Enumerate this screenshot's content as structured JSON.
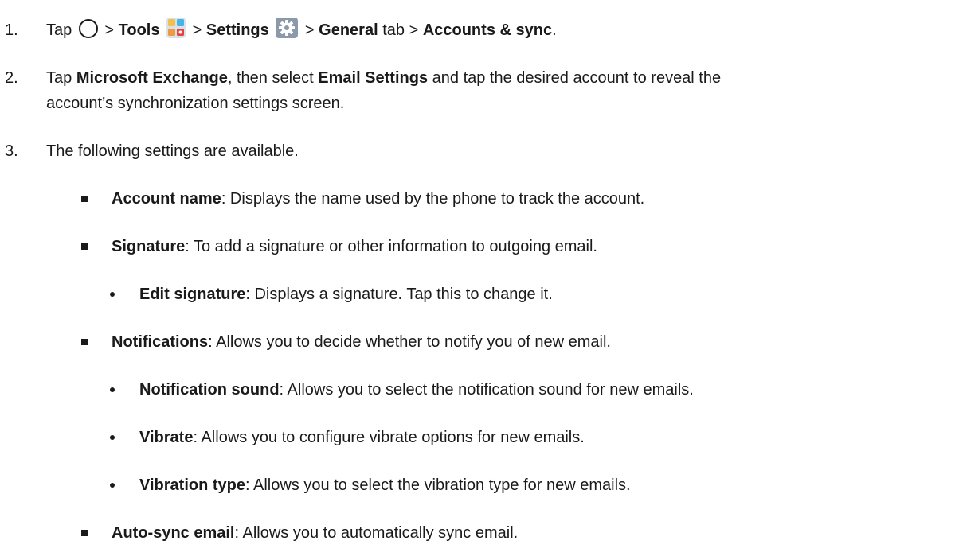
{
  "steps": [
    {
      "number": "1.",
      "tap": "Tap",
      "sep": ">",
      "tools": "Tools",
      "settings": "Settings",
      "general": "General",
      "tab": "tab",
      "accounts": "Accounts & sync",
      "period": "."
    },
    {
      "number": "2.",
      "tap": "Tap",
      "exchange": "Microsoft Exchange",
      "then_select": ", then select",
      "email_settings": "Email Settings",
      "rest_line1": "and tap the desired account to reveal the",
      "line2": "account’s synchronization settings screen."
    },
    {
      "number": "3.",
      "text": "The following settings are available."
    }
  ],
  "settings": [
    {
      "term": "Account name",
      "desc": ": Displays the name used by the phone to track the account."
    },
    {
      "term": "Signature",
      "desc": ": To add a signature or other information to outgoing email."
    },
    {
      "term": "Edit signature",
      "desc": ": Displays a signature. Tap this to change it."
    },
    {
      "term": "Notifications",
      "desc": ": Allows you to decide whether to notify you of new email."
    },
    {
      "term": "Notification sound",
      "desc": ": Allows you to select the notification sound for new emails."
    },
    {
      "term": "Vibrate",
      "desc": ": Allows you to configure vibrate options for new emails."
    },
    {
      "term": "Vibration type",
      "desc": ": Allows you to select the vibration type for new emails."
    },
    {
      "term": "Auto-sync email",
      "desc": ": Allows you to automatically sync email."
    }
  ],
  "icons": {
    "home": "home-circle-icon",
    "tools": "tools-folder-icon",
    "settings": "settings-gear-icon"
  }
}
